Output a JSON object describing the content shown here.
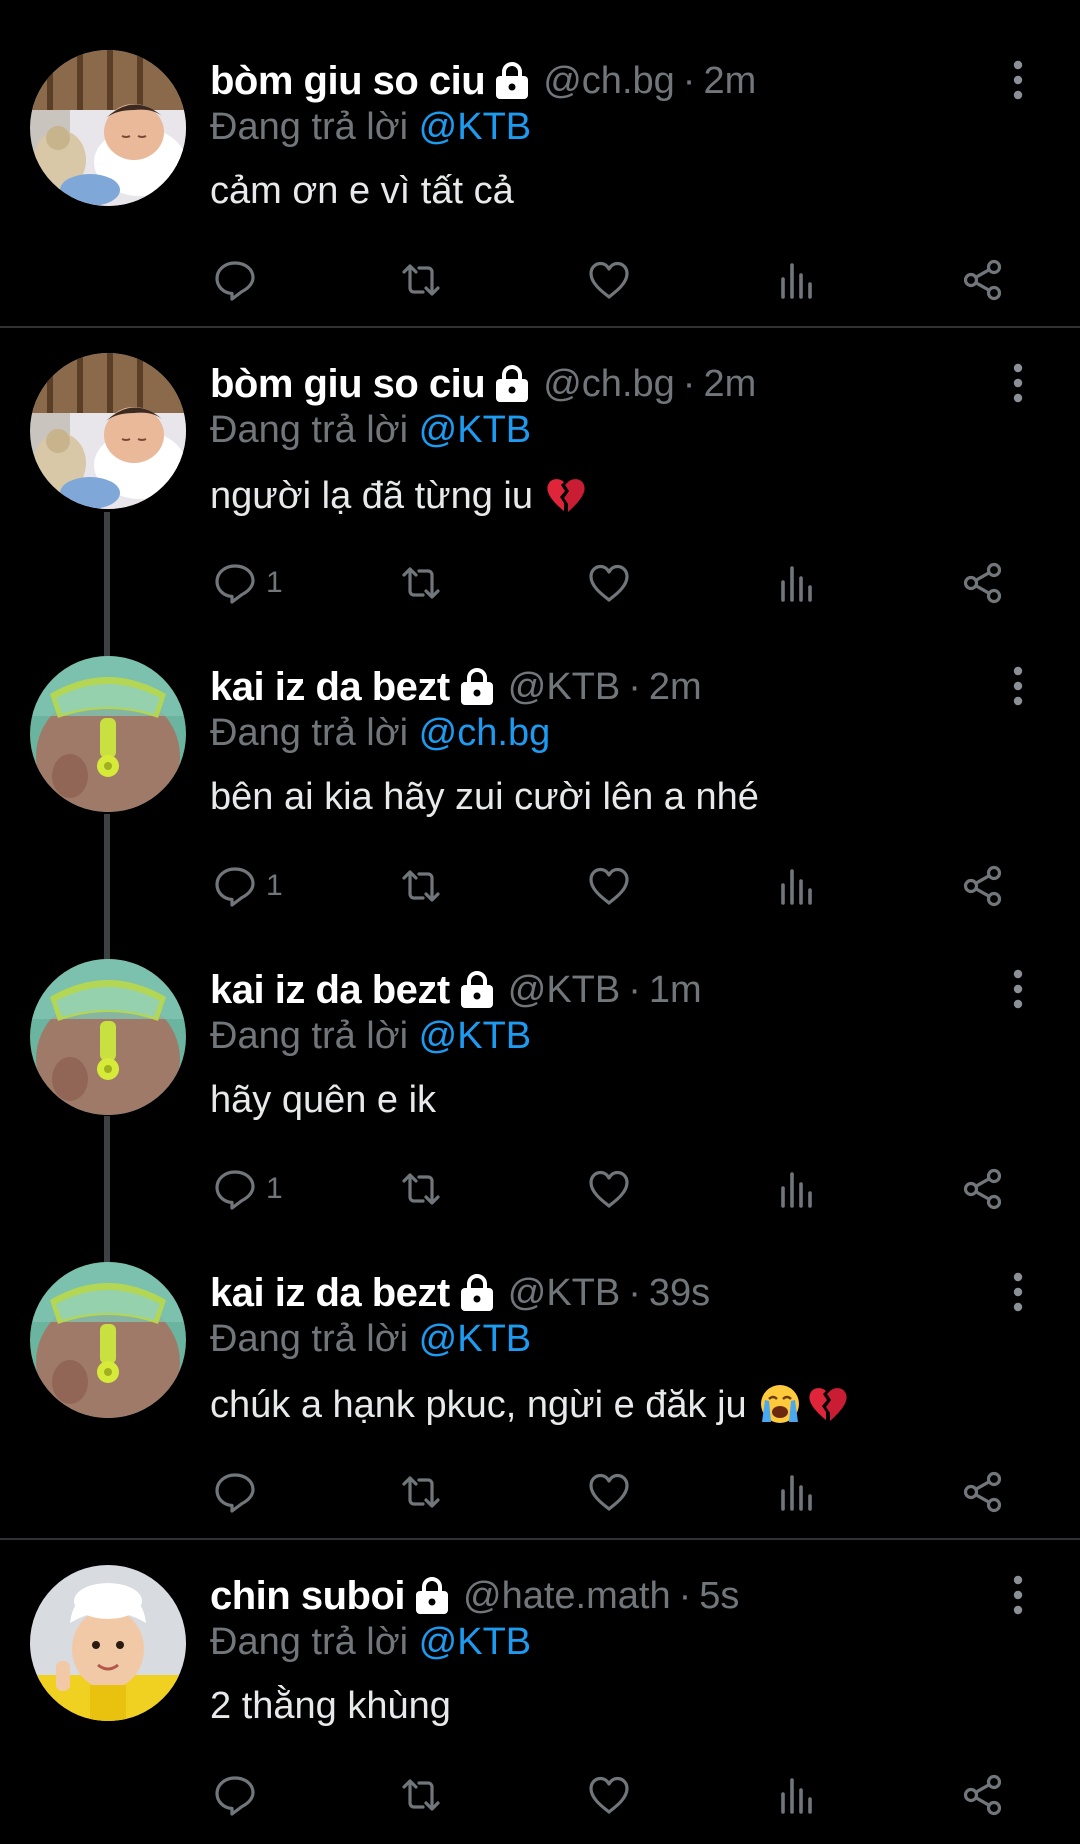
{
  "tweets": [
    {
      "name": "bòm giu so ciu",
      "handle": "@ch.bg",
      "time": "2m",
      "reply_prefix": "Đang trả lời",
      "reply_to": "@KTB",
      "text": "cảm ơn e vì tất cả",
      "emojis": [],
      "reply_count": "",
      "avatar": "baby-sleeping"
    },
    {
      "name": "bòm giu so ciu",
      "handle": "@ch.bg",
      "time": "2m",
      "reply_prefix": "Đang trả lời",
      "reply_to": "@KTB",
      "text": "người lạ đã từng iu",
      "emojis": [
        "broken-heart"
      ],
      "reply_count": "1",
      "avatar": "baby-sleeping"
    },
    {
      "name": "kai iz da bezt",
      "handle": "@KTB",
      "time": "2m",
      "reply_prefix": "Đang trả lời",
      "reply_to": "@ch.bg",
      "text": "bên ai kia hãy zui cười lên a nhé",
      "emojis": [],
      "reply_count": "1",
      "avatar": "snorkel-kid"
    },
    {
      "name": "kai iz da bezt",
      "handle": "@KTB",
      "time": "1m",
      "reply_prefix": "Đang trả lời",
      "reply_to": "@KTB",
      "text": "hãy quên e ik",
      "emojis": [],
      "reply_count": "1",
      "avatar": "snorkel-kid"
    },
    {
      "name": "kai iz da bezt",
      "handle": "@KTB",
      "time": "39s",
      "reply_prefix": "Đang trả lời",
      "reply_to": "@KTB",
      "text": "chúk a hạnk pkuc, ngừi e đăk ju",
      "emojis": [
        "loudly-crying-face",
        "broken-heart"
      ],
      "reply_count": "",
      "avatar": "snorkel-kid"
    },
    {
      "name": "chin suboi",
      "handle": "@hate.math",
      "time": "5s",
      "reply_prefix": "Đang trả lời",
      "reply_to": "@KTB",
      "text": "2 thằng khùng",
      "emojis": [],
      "reply_count": "",
      "avatar": "kid-chef-hat"
    }
  ],
  "colors": {
    "background": "#000000",
    "text": "#e7e9ea",
    "secondary": "#71767b",
    "link": "#1d9bf0",
    "divider": "#2f3336",
    "thread_line": "#3e4144"
  },
  "icons": [
    "lock-icon",
    "more-icon",
    "reply-icon",
    "retweet-icon",
    "like-icon",
    "views-icon",
    "share-icon"
  ]
}
